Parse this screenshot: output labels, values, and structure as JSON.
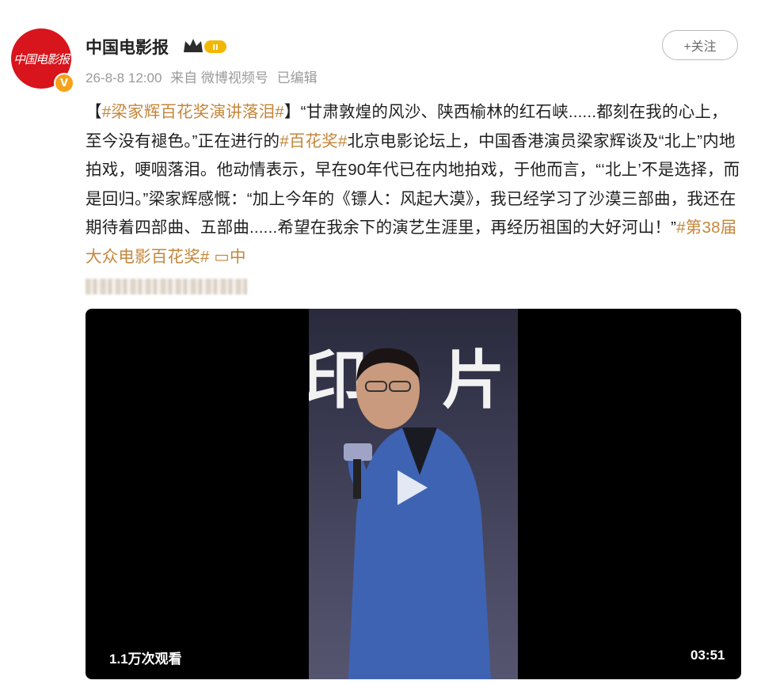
{
  "post": {
    "author": "中国电影报",
    "avatar_text": "中国电影报",
    "verified_mark": "V",
    "level_badge": "II",
    "date": "26-8-8 12:00",
    "source": "来自 微博视频号",
    "edited": "已编辑",
    "follow_label": "+关注",
    "content": {
      "p1_open": "【",
      "tag1": "#梁家辉百花奖演讲落泪#",
      "p1_close": "】",
      "text1": "“甘肃敦煌的风沙、陕西榆林的红石峡......都刻在我的心上，至今没有褪色。”正在进行的",
      "tag2": "#百花奖#",
      "text2": "北京电影论坛上，中国香港演员梁家辉谈及“北上”内地拍戏，哽咽落泪。他动情表示，早在90年代已在内地拍戏，于他而言，“‘北上’不是选择，而是回归。”梁家辉感慨：“加上今年的《镖人：风起大漠》，我已经学习了沙漠三部曲，我还在期待着四部曲、五部曲......希望在我余下的演艺生涯里，再经历祖国的大好河山！”",
      "tag3": "#第38届大众电影百花奖#",
      "link_icon": "▭",
      "link_text": "中"
    },
    "video": {
      "views": "1.1万次观看",
      "duration": "03:51",
      "bg_glyph_1": "印",
      "bg_glyph_2": "片"
    }
  },
  "colors": {
    "tag": "#c4863a",
    "avatar_red": "#d8141c",
    "meta_gray": "#9a9a9a"
  }
}
